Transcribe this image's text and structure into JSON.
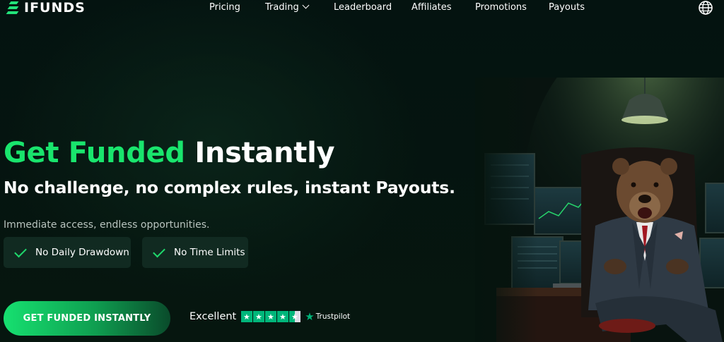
{
  "brand": {
    "name": "IFUNDS",
    "accent": "#19e56d"
  },
  "nav": {
    "links": [
      {
        "label": "Pricing"
      },
      {
        "label": "Trading",
        "has_dropdown": true
      },
      {
        "label": "Leaderboard"
      },
      {
        "label": "Affiliates"
      },
      {
        "label": "Promotions"
      },
      {
        "label": "Payouts"
      }
    ],
    "language_icon": "globe-icon"
  },
  "hero": {
    "title_accent": "Get Funded",
    "title_rest": "Instantly",
    "subtitle": "No challenge, no complex rules, instant Payouts.",
    "tagline": "Immediate access, endless opportunities.",
    "features": [
      {
        "label": "No Daily Drawdown",
        "icon": "check-icon"
      },
      {
        "label": "No Time Limits",
        "icon": "check-icon"
      }
    ],
    "cta_label": "GET FUNDED INSTANTLY"
  },
  "trustpilot": {
    "rating_text": "Excellent",
    "stars": 4.5,
    "brand": "Trustpilot",
    "color": "#00b67a"
  }
}
